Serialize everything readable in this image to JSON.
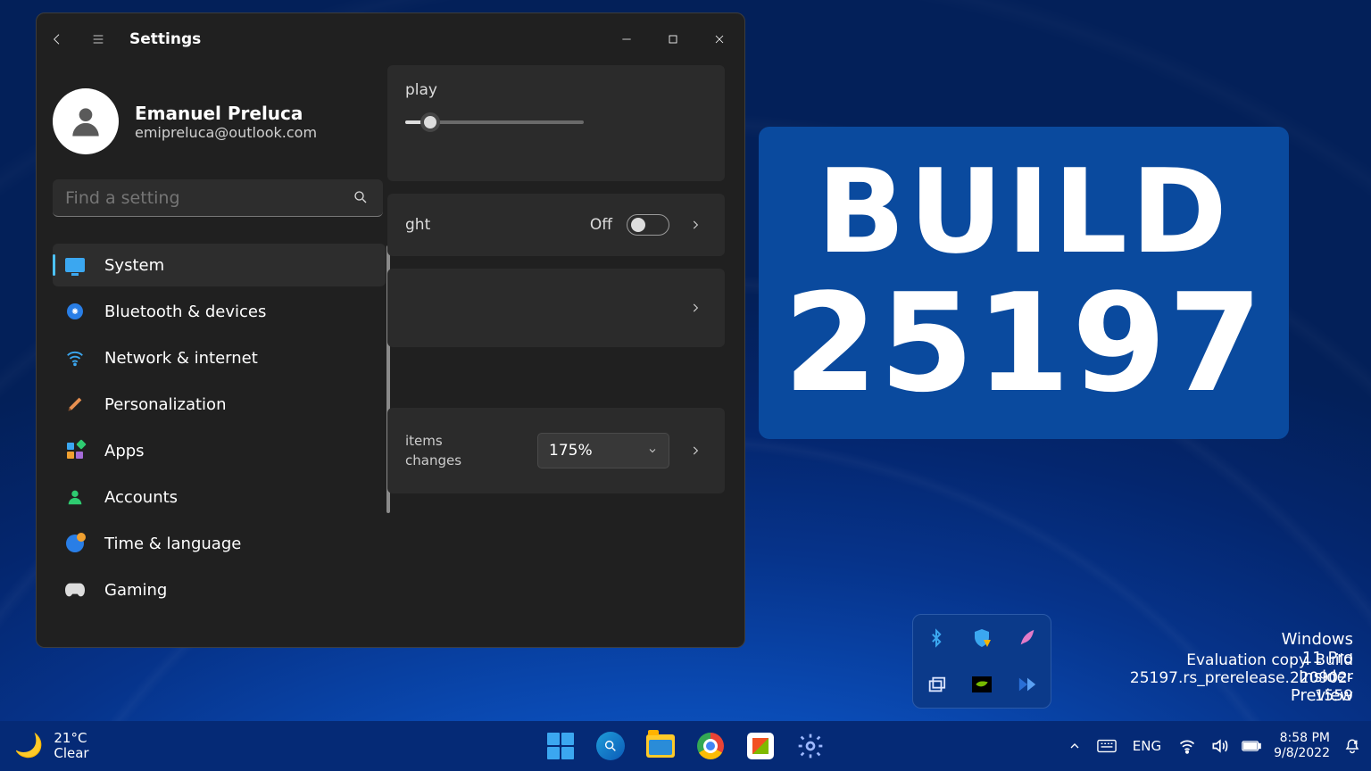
{
  "banner": {
    "line1": "BUILD",
    "line2": "25197"
  },
  "watermark": {
    "line1": "Windows 11 Pro Insider Preview",
    "line2": "Evaluation copy. Build 25197.rs_prerelease.220902-1559"
  },
  "settings": {
    "title": "Settings",
    "user": {
      "name": "Emanuel Preluca",
      "email": "emipreluca@outlook.com"
    },
    "search_placeholder": "Find a setting",
    "nav": [
      {
        "label": "System",
        "active": true
      },
      {
        "label": "Bluetooth & devices"
      },
      {
        "label": "Network & internet"
      },
      {
        "label": "Personalization"
      },
      {
        "label": "Apps"
      },
      {
        "label": "Accounts"
      },
      {
        "label": "Time & language"
      },
      {
        "label": "Gaming"
      }
    ],
    "content": {
      "card1_label": "play",
      "nightlight_visible_label": "ght",
      "nightlight_state": "Off",
      "scale": {
        "text_line1": "items",
        "text_line2": "changes",
        "value": "175%"
      }
    }
  },
  "taskbar": {
    "weather": {
      "temp": "21°C",
      "cond": "Clear"
    },
    "lang": "ENG",
    "time": "8:58 PM",
    "date": "9/8/2022"
  }
}
